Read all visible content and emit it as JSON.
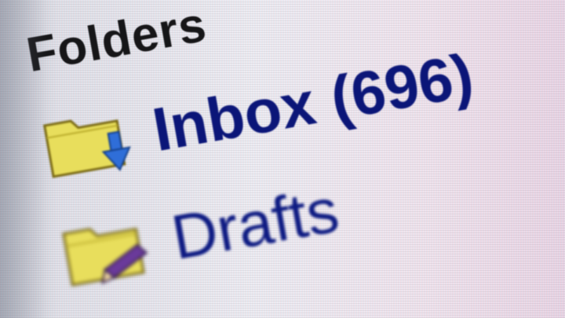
{
  "folders_pane": {
    "heading": "Folders",
    "items": [
      {
        "label": "Inbox",
        "count": "(696)",
        "icon": "folder-download-icon"
      },
      {
        "label": "Drafts",
        "icon": "folder-edit-icon"
      }
    ]
  },
  "colors": {
    "heading_text": "#161618",
    "link_text": "#0b1678",
    "folder_yellow": "#e8de5c",
    "arrow_blue": "#2f6ed8",
    "pencil_purple": "#6a3a9a"
  }
}
